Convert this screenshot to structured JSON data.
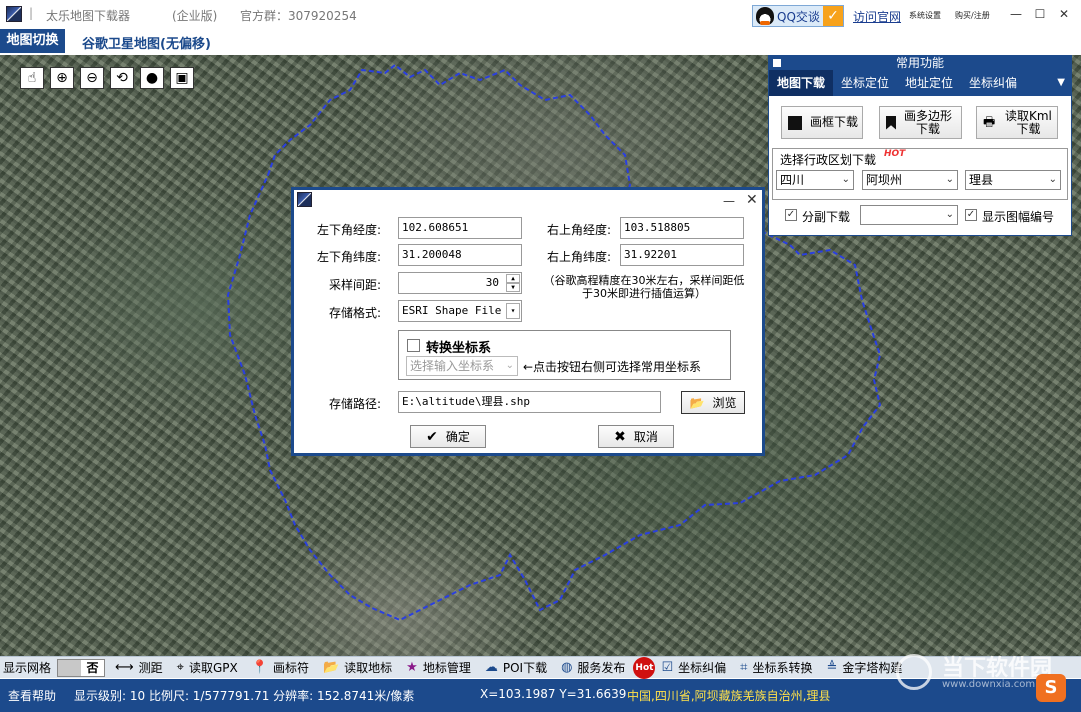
{
  "titlebar": {
    "title": "太乐地图下载器",
    "edition": "(企业版)",
    "qq_group": "官方群：307920254",
    "qq_chat": "QQ交谈",
    "visit_site": "访问官网",
    "sys_settings": "系统设置",
    "buy_register": "购买/注册",
    "separator": "|"
  },
  "mapbar": {
    "switch_label": "地图切换",
    "map_name": "谷歌卫星地图(无偏移)"
  },
  "map_tools": [
    "pointer-icon",
    "zoom-in-icon",
    "zoom-out-icon",
    "refresh-icon",
    "globe-icon",
    "screenshot-icon"
  ],
  "panel": {
    "header": "常用功能",
    "tabs": [
      "地图下载",
      "坐标定位",
      "地址定位",
      "坐标纠偏"
    ],
    "buttons": {
      "rect_download": "画框下载",
      "polygon_download_1": "画多边形",
      "polygon_download_2": "下载",
      "kml_download_1": "读取Kml",
      "kml_download_2": "下载"
    },
    "region_title": "选择行政区划下载",
    "hot": "HOT",
    "province": "四川",
    "prefecture": "阿坝州",
    "county": "理县",
    "sheet_download": "分副下载",
    "sheet_select": "",
    "show_sheet_number": "显示图幅编号"
  },
  "dialog": {
    "labels": {
      "ll_lon": "左下角经度:",
      "ur_lon": "右上角经度:",
      "ll_lat": "左下角纬度:",
      "ur_lat": "右上角纬度:",
      "sample": "采样间距:",
      "format": "存储格式:",
      "path": "存储路径:"
    },
    "values": {
      "ll_lon": "102.608651",
      "ur_lon": "103.518805",
      "ll_lat": "31.200048",
      "ur_lat": "31.92201",
      "sample": "30",
      "format": "ESRI Shape File",
      "path": "E:\\altitude\\理县.shp"
    },
    "note": "（谷歌高程精度在30米左右，采样间距低于30米即进行插值运算）",
    "convert_label": "转换坐标系",
    "coord_select": "选择输入坐标系",
    "coord_hint": "←点击按钮右侧可选择常用坐标系",
    "browse": "浏览",
    "ok": "确定",
    "cancel": "取消"
  },
  "bottombar": {
    "show_grid": "显示网格",
    "grid_off": "否",
    "measure": "测距",
    "read_gpx": "读取GPX",
    "draw_marker": "画标符",
    "read_marker": "读取地标",
    "marker_manage": "地标管理",
    "poi_download": "POI下载",
    "publish": "服务发布",
    "hot": "Hot",
    "coord_correct": "坐标纠偏",
    "coord_convert": "坐标系转换",
    "pyramid": "金字塔构建"
  },
  "statusbar": {
    "help": "查看帮助",
    "info": "显示级别: 10 比例尺: 1/577791.71 分辨率: 152.8741米/像素",
    "coords": "X=103.1987 Y=31.6639",
    "place": "中国,四川省,阿坝藏族羌族自治州,理县"
  },
  "watermark": {
    "text": "当下软件园",
    "url": "www.downxia.com",
    "logo": "S"
  },
  "colors": {
    "brand_blue": "#1c4a8c",
    "boundary": "#2a3fe0",
    "place_text": "#ffe14a",
    "hot_red": "#d01010"
  }
}
